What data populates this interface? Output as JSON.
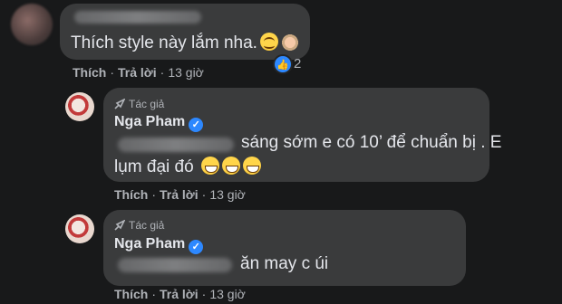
{
  "comment": {
    "text": "Thích style này lắm nha.",
    "reaction_count": "2",
    "actions": {
      "like": "Thích",
      "reply": "Trả lời",
      "time": "13 giờ"
    }
  },
  "replies": [
    {
      "badge": "Tác giả",
      "author": "Nga Pham",
      "text_line1": "sáng sớm e có 10’ để chuẩn bị . E",
      "text_line2": "lụm đại đó",
      "actions": {
        "like": "Thích",
        "reply": "Trả lời",
        "time": "13 giờ"
      }
    },
    {
      "badge": "Tác giả",
      "author": "Nga Pham",
      "text_line1": "ăn may c úi",
      "actions": {
        "like": "Thích",
        "reply": "Trả lời",
        "time": "13 giờ"
      }
    }
  ],
  "icons": {
    "like": "thumbs-up-icon",
    "verified": "verified-badge-icon",
    "author": "author-badge-icon"
  },
  "colors": {
    "background": "#18191a",
    "bubble": "#3a3b3c",
    "accent": "#2d88ff"
  }
}
